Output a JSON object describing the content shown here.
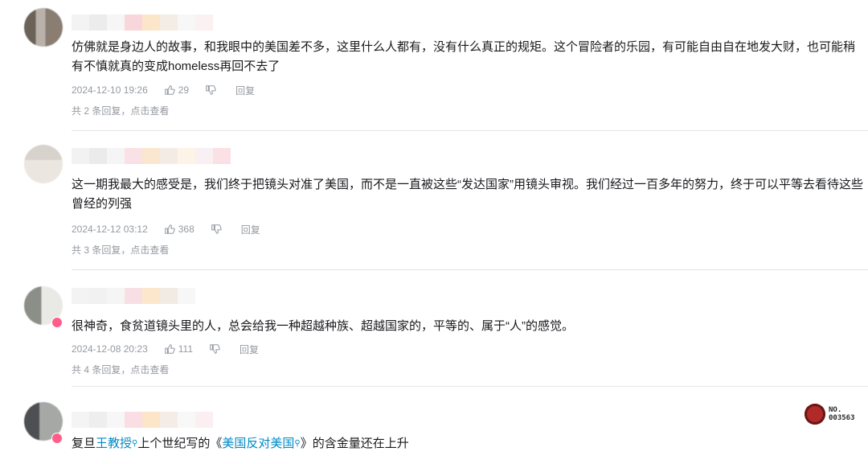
{
  "comments": [
    {
      "text": "仿佛就是身边人的故事，和我眼中的美国差不多，这里什么人都有，没有什么真正的规矩。这个冒险者的乐园，有可能自由自在地发大财，也可能稍有不慎就真的变成homeless再回不去了",
      "date": "2024-12-10 19:26",
      "likes": "29",
      "reply_label": "回复",
      "reply_count_text": "共 2 条回复，点击查看"
    },
    {
      "text": "这一期我最大的感受是，我们终于把镜头对准了美国，而不是一直被这些“发达国家”用镜头审视。我们经过一百多年的努力，终于可以平等去看待这些曾经的列强",
      "date": "2024-12-12 03:12",
      "likes": "368",
      "reply_label": "回复",
      "reply_count_text": "共 3 条回复，点击查看"
    },
    {
      "text": "很神奇，食贫道镜头里的人，总会给我一种超越种族、超越国家的，平等的、属于“人”的感觉。",
      "date": "2024-12-08 20:23",
      "likes": "111",
      "reply_label": "回复",
      "reply_count_text": "共 4 条回复，点击查看"
    },
    {
      "text_prefix": "复旦",
      "link1": "王教授",
      "text_mid": "上个世纪写的《",
      "link2": "美国反对美国",
      "text_suffix": "》的含金量还在上升"
    }
  ],
  "nft_label_line1": "NO.",
  "nft_label_line2": "003563",
  "icons": {
    "like": "thumb-up-icon",
    "dislike": "thumb-down-icon",
    "search_hint": "search-hint-icon"
  },
  "colors": {
    "text": "#18191c",
    "meta": "#9499a0",
    "link": "#008ac5",
    "divider": "#e3e5e7"
  }
}
